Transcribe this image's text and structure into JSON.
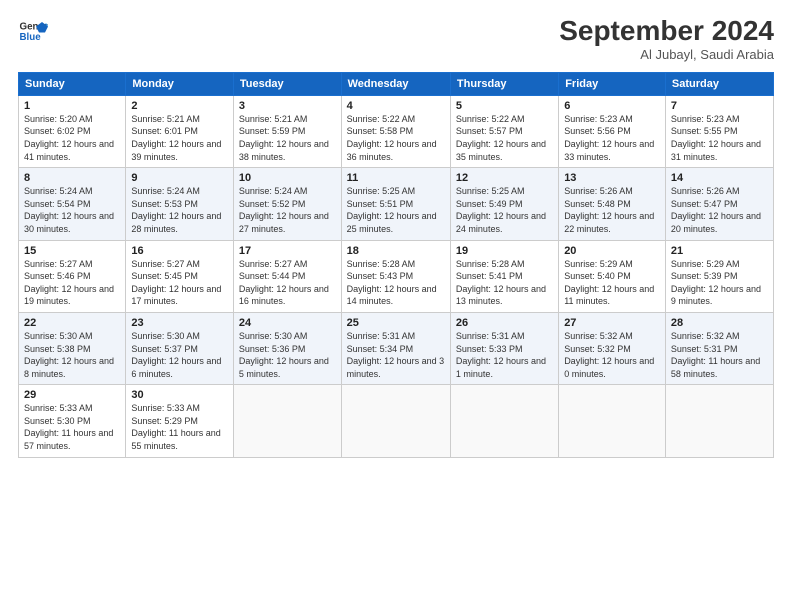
{
  "header": {
    "logo_line1": "General",
    "logo_line2": "Blue",
    "month": "September 2024",
    "location": "Al Jubayl, Saudi Arabia"
  },
  "weekdays": [
    "Sunday",
    "Monday",
    "Tuesday",
    "Wednesday",
    "Thursday",
    "Friday",
    "Saturday"
  ],
  "weeks": [
    [
      {
        "day": "1",
        "sunrise": "Sunrise: 5:20 AM",
        "sunset": "Sunset: 6:02 PM",
        "daylight": "Daylight: 12 hours and 41 minutes."
      },
      {
        "day": "2",
        "sunrise": "Sunrise: 5:21 AM",
        "sunset": "Sunset: 6:01 PM",
        "daylight": "Daylight: 12 hours and 39 minutes."
      },
      {
        "day": "3",
        "sunrise": "Sunrise: 5:21 AM",
        "sunset": "Sunset: 5:59 PM",
        "daylight": "Daylight: 12 hours and 38 minutes."
      },
      {
        "day": "4",
        "sunrise": "Sunrise: 5:22 AM",
        "sunset": "Sunset: 5:58 PM",
        "daylight": "Daylight: 12 hours and 36 minutes."
      },
      {
        "day": "5",
        "sunrise": "Sunrise: 5:22 AM",
        "sunset": "Sunset: 5:57 PM",
        "daylight": "Daylight: 12 hours and 35 minutes."
      },
      {
        "day": "6",
        "sunrise": "Sunrise: 5:23 AM",
        "sunset": "Sunset: 5:56 PM",
        "daylight": "Daylight: 12 hours and 33 minutes."
      },
      {
        "day": "7",
        "sunrise": "Sunrise: 5:23 AM",
        "sunset": "Sunset: 5:55 PM",
        "daylight": "Daylight: 12 hours and 31 minutes."
      }
    ],
    [
      {
        "day": "8",
        "sunrise": "Sunrise: 5:24 AM",
        "sunset": "Sunset: 5:54 PM",
        "daylight": "Daylight: 12 hours and 30 minutes."
      },
      {
        "day": "9",
        "sunrise": "Sunrise: 5:24 AM",
        "sunset": "Sunset: 5:53 PM",
        "daylight": "Daylight: 12 hours and 28 minutes."
      },
      {
        "day": "10",
        "sunrise": "Sunrise: 5:24 AM",
        "sunset": "Sunset: 5:52 PM",
        "daylight": "Daylight: 12 hours and 27 minutes."
      },
      {
        "day": "11",
        "sunrise": "Sunrise: 5:25 AM",
        "sunset": "Sunset: 5:51 PM",
        "daylight": "Daylight: 12 hours and 25 minutes."
      },
      {
        "day": "12",
        "sunrise": "Sunrise: 5:25 AM",
        "sunset": "Sunset: 5:49 PM",
        "daylight": "Daylight: 12 hours and 24 minutes."
      },
      {
        "day": "13",
        "sunrise": "Sunrise: 5:26 AM",
        "sunset": "Sunset: 5:48 PM",
        "daylight": "Daylight: 12 hours and 22 minutes."
      },
      {
        "day": "14",
        "sunrise": "Sunrise: 5:26 AM",
        "sunset": "Sunset: 5:47 PM",
        "daylight": "Daylight: 12 hours and 20 minutes."
      }
    ],
    [
      {
        "day": "15",
        "sunrise": "Sunrise: 5:27 AM",
        "sunset": "Sunset: 5:46 PM",
        "daylight": "Daylight: 12 hours and 19 minutes."
      },
      {
        "day": "16",
        "sunrise": "Sunrise: 5:27 AM",
        "sunset": "Sunset: 5:45 PM",
        "daylight": "Daylight: 12 hours and 17 minutes."
      },
      {
        "day": "17",
        "sunrise": "Sunrise: 5:27 AM",
        "sunset": "Sunset: 5:44 PM",
        "daylight": "Daylight: 12 hours and 16 minutes."
      },
      {
        "day": "18",
        "sunrise": "Sunrise: 5:28 AM",
        "sunset": "Sunset: 5:43 PM",
        "daylight": "Daylight: 12 hours and 14 minutes."
      },
      {
        "day": "19",
        "sunrise": "Sunrise: 5:28 AM",
        "sunset": "Sunset: 5:41 PM",
        "daylight": "Daylight: 12 hours and 13 minutes."
      },
      {
        "day": "20",
        "sunrise": "Sunrise: 5:29 AM",
        "sunset": "Sunset: 5:40 PM",
        "daylight": "Daylight: 12 hours and 11 minutes."
      },
      {
        "day": "21",
        "sunrise": "Sunrise: 5:29 AM",
        "sunset": "Sunset: 5:39 PM",
        "daylight": "Daylight: 12 hours and 9 minutes."
      }
    ],
    [
      {
        "day": "22",
        "sunrise": "Sunrise: 5:30 AM",
        "sunset": "Sunset: 5:38 PM",
        "daylight": "Daylight: 12 hours and 8 minutes."
      },
      {
        "day": "23",
        "sunrise": "Sunrise: 5:30 AM",
        "sunset": "Sunset: 5:37 PM",
        "daylight": "Daylight: 12 hours and 6 minutes."
      },
      {
        "day": "24",
        "sunrise": "Sunrise: 5:30 AM",
        "sunset": "Sunset: 5:36 PM",
        "daylight": "Daylight: 12 hours and 5 minutes."
      },
      {
        "day": "25",
        "sunrise": "Sunrise: 5:31 AM",
        "sunset": "Sunset: 5:34 PM",
        "daylight": "Daylight: 12 hours and 3 minutes."
      },
      {
        "day": "26",
        "sunrise": "Sunrise: 5:31 AM",
        "sunset": "Sunset: 5:33 PM",
        "daylight": "Daylight: 12 hours and 1 minute."
      },
      {
        "day": "27",
        "sunrise": "Sunrise: 5:32 AM",
        "sunset": "Sunset: 5:32 PM",
        "daylight": "Daylight: 12 hours and 0 minutes."
      },
      {
        "day": "28",
        "sunrise": "Sunrise: 5:32 AM",
        "sunset": "Sunset: 5:31 PM",
        "daylight": "Daylight: 11 hours and 58 minutes."
      }
    ],
    [
      {
        "day": "29",
        "sunrise": "Sunrise: 5:33 AM",
        "sunset": "Sunset: 5:30 PM",
        "daylight": "Daylight: 11 hours and 57 minutes."
      },
      {
        "day": "30",
        "sunrise": "Sunrise: 5:33 AM",
        "sunset": "Sunset: 5:29 PM",
        "daylight": "Daylight: 11 hours and 55 minutes."
      },
      null,
      null,
      null,
      null,
      null
    ]
  ]
}
